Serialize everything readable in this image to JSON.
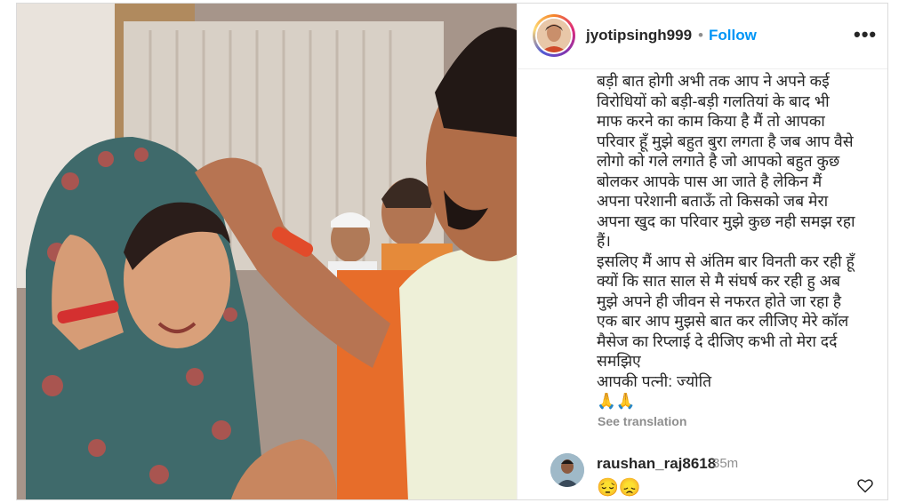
{
  "header": {
    "username": "jyotipsingh999",
    "separator": "•",
    "follow_label": "Follow",
    "more_label": "•••"
  },
  "caption": {
    "lines": [
      "बड़ी बात होगी अभी तक आप ने अपने कई",
      "विरोधियों को बड़ी-बड़ी गलतियां के बाद भी",
      "माफ करने का काम किया है मैं तो आपका",
      "परिवार हूँ मुझे बहुत बुरा लगता है जब आप वैसे",
      "लोगो को गले लगाते है जो आपको बहुत कुछ",
      "बोलकर आपके पास आ जाते है लेकिन मैं",
      "अपना परेशानी बताऊँ तो किसको जब मेरा",
      "अपना खुद का परिवार मुझे कुछ नही समझ रहा",
      "हैं।",
      "इसलिए मैं आप से अंतिम बार विनती कर रही हूँ",
      "क्यों कि सात साल से मै संघर्ष कर रही हु अब",
      "मुझे अपने ही जीवन से नफरत होते जा रहा है",
      "एक बार आप मुझसे बात कर लीजिए मेरे कॉल",
      "मैसेज का रिप्लाई दे दीजिए कभी तो मेरा दर्द",
      "समझिए",
      "आपकी पत्नी: ज्योति"
    ],
    "emoji": "🙏🙏",
    "see_translation": "See translation"
  },
  "comment": {
    "username": "raushan_raj8618",
    "time": "35m",
    "text": "😔😞"
  },
  "colors": {
    "accent": "#0095f6",
    "text": "#262626",
    "muted": "#8e8e8e",
    "border": "#dbdbdb"
  },
  "icons": [
    "more-icon",
    "heart-icon",
    "scroll-up-icon",
    "scroll-down-icon"
  ]
}
